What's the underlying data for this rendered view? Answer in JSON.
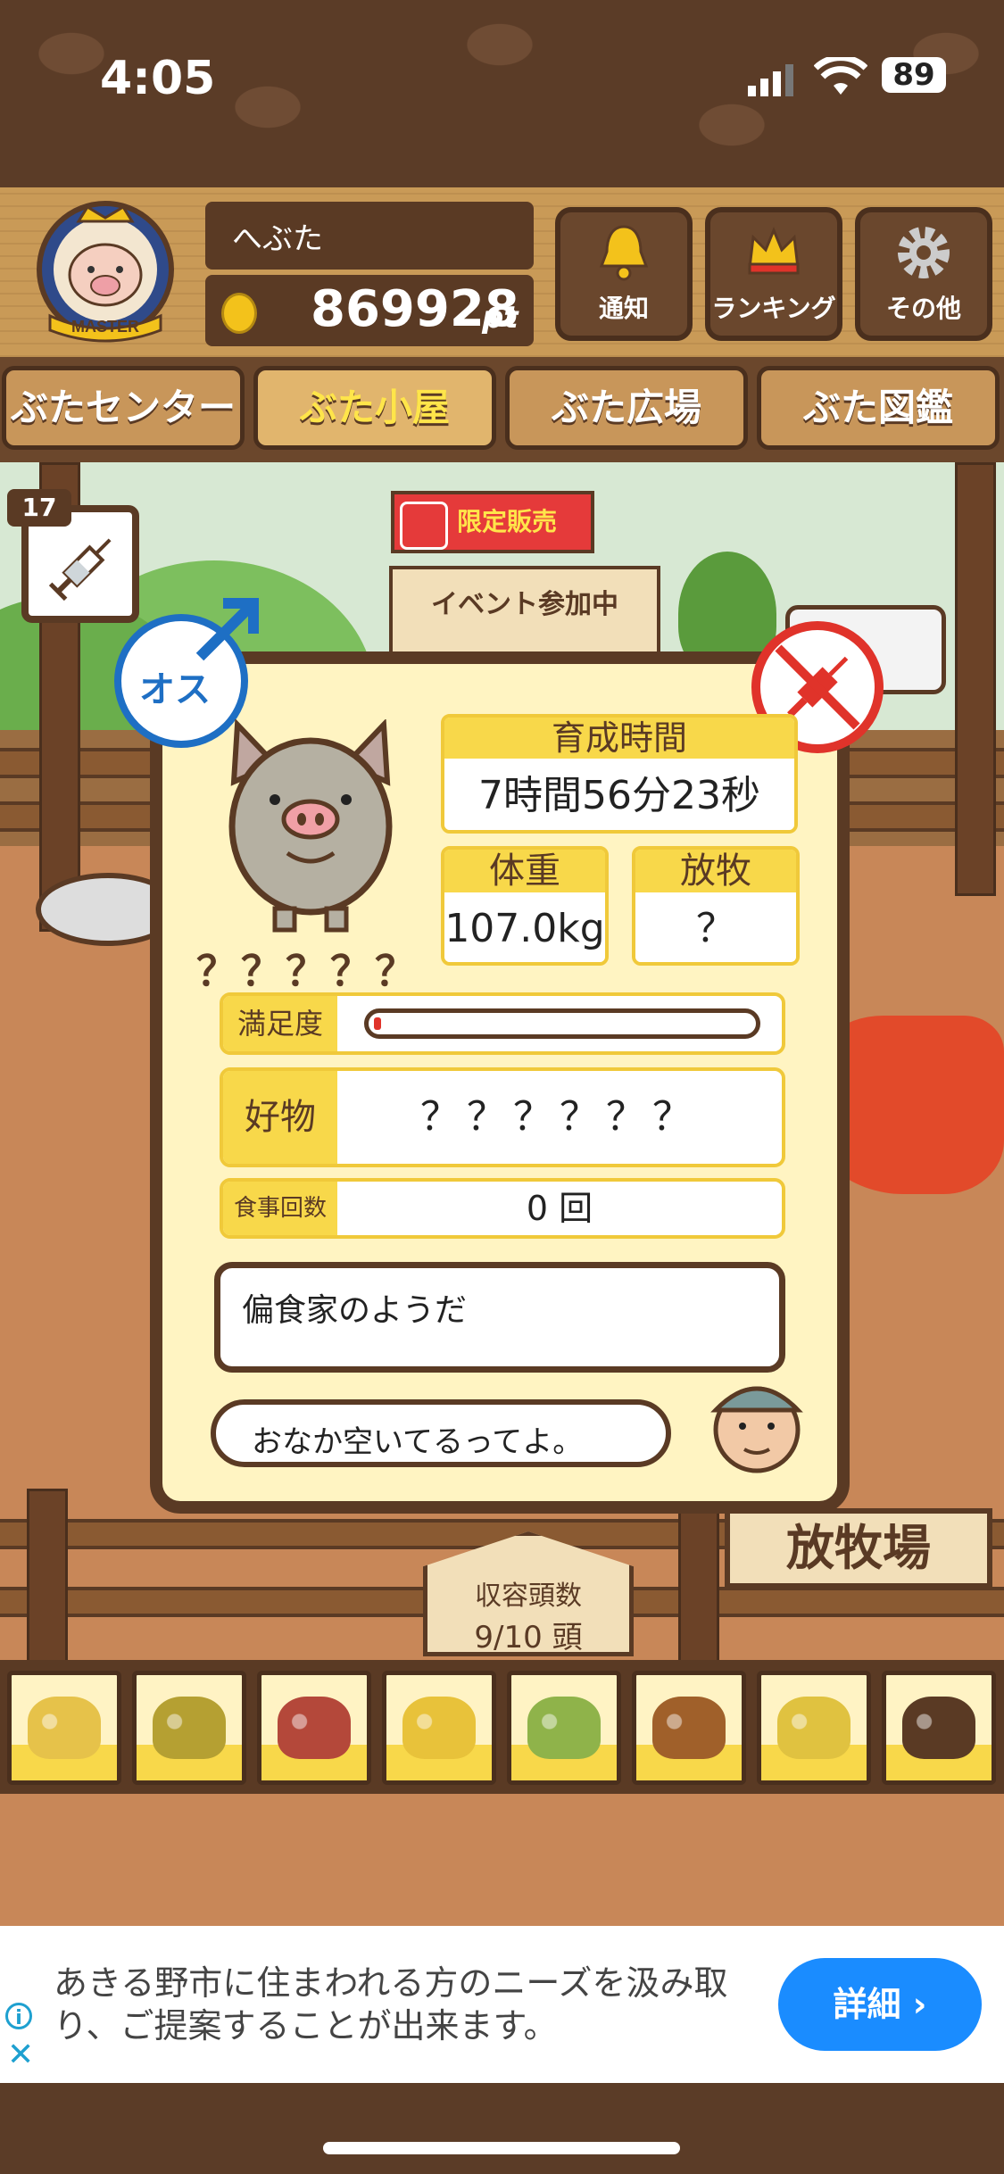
{
  "status": {
    "time": "4:05",
    "battery": "89"
  },
  "header": {
    "username": "へぶた",
    "points": "869928",
    "points_unit": "pt",
    "buttons": [
      {
        "label": "通知",
        "icon": "bell-icon"
      },
      {
        "label": "ランキング",
        "icon": "crown-icon"
      },
      {
        "label": "その他",
        "icon": "gear-icon"
      }
    ],
    "avatar_badge": "MASTER"
  },
  "tabs": [
    {
      "label": "ぶたセンター",
      "active": false
    },
    {
      "label": "ぶた小屋",
      "active": true
    },
    {
      "label": "ぶた広場",
      "active": false
    },
    {
      "label": "ぶた図鑑",
      "active": false
    }
  ],
  "scene": {
    "syringe_count": "17",
    "sale_label": "限定販売",
    "event_label": "イベント参加中",
    "capacity_label": "収容頭数",
    "capacity_value": "9/10 頭",
    "pasture_sign": "放牧場"
  },
  "pig_panel": {
    "gender": "オス",
    "pig_name": "？？？？？",
    "growth_label": "育成時間",
    "growth_value": "7時間56分23秒",
    "weight_label": "体重",
    "weight_value": "107.0kg",
    "graze_label": "放牧",
    "graze_value": "？",
    "satisfaction_label": "満足度",
    "satisfaction_fraction": 0.02,
    "favorite_label": "好物",
    "favorite_value": "？？？？？？",
    "meals_label": "食事回数",
    "meals_value": "0 回",
    "message": "偏食家のようだ",
    "farmer_message": "おなか空いてるってよ。"
  },
  "food_items": [
    {
      "icon": "soybean-icon",
      "color": "#e6c24a"
    },
    {
      "icon": "mixed-grain-icon",
      "color": "#b5a032"
    },
    {
      "icon": "sweet-potato-icon",
      "color": "#b4483a"
    },
    {
      "icon": "corn-icon",
      "color": "#e8c23a"
    },
    {
      "icon": "nuts-leaf-icon",
      "color": "#8fb34a"
    },
    {
      "icon": "acorn-icon",
      "color": "#a0602a"
    },
    {
      "icon": "grain-plate-icon",
      "color": "#e0c240"
    },
    {
      "icon": "truffle-icon",
      "color": "#5a3a24"
    }
  ],
  "ad": {
    "text": "あきる野市に住まわれる方のニーズを汲み取り、ご提案することが出来ます。",
    "button": "詳細 ›"
  }
}
